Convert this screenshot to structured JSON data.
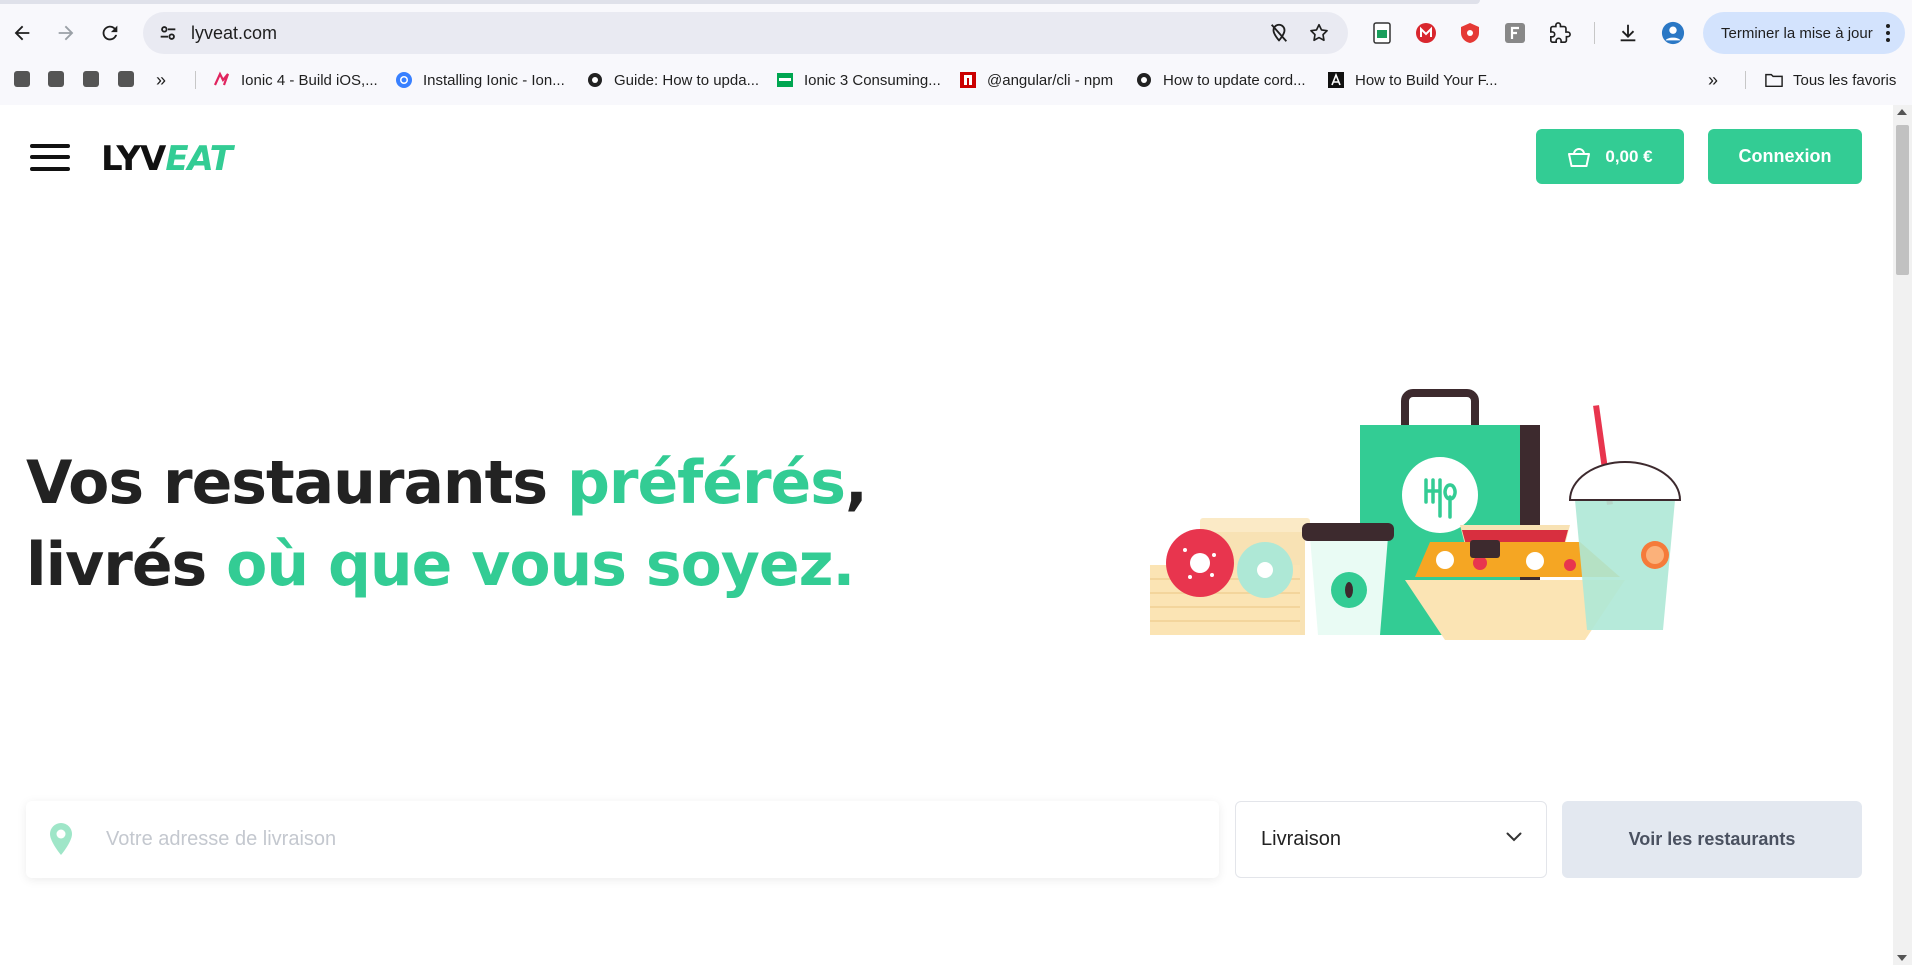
{
  "browser": {
    "url": "lyveat.com",
    "update_label": "Terminer la mise à jour",
    "bookmarks": [
      {
        "label": "Ionic 4 - Build iOS,...",
        "color": "#e0245e"
      },
      {
        "label": "Installing Ionic - Ion...",
        "color": "#3880ff"
      },
      {
        "label": "Guide: How to upda...",
        "color": "#222222"
      },
      {
        "label": "Ionic 3 Consuming...",
        "color": "#00a651"
      },
      {
        "label": "@angular/cli - npm",
        "color": "#cb0000"
      },
      {
        "label": "How to update cord...",
        "color": "#222222"
      },
      {
        "label": "How to Build Your F...",
        "color": "#111111"
      }
    ],
    "all_bookmarks_label": "Tous les favoris"
  },
  "header": {
    "logo_part1": "LYV",
    "logo_part2": "EAT",
    "cart_total": "0,00 €",
    "login_label": "Connexion"
  },
  "hero": {
    "line1_dark": "Vos restaurants ",
    "line1_green": "préférés",
    "line1_comma": ",",
    "line2_dark": "livrés ",
    "line2_green": "où que vous soyez."
  },
  "search": {
    "address_placeholder": "Votre adresse de livraison",
    "mode_value": "Livraison",
    "submit_label": "Voir les restaurants"
  },
  "colors": {
    "brand_green": "#33cc94",
    "text_dark": "#222222"
  }
}
